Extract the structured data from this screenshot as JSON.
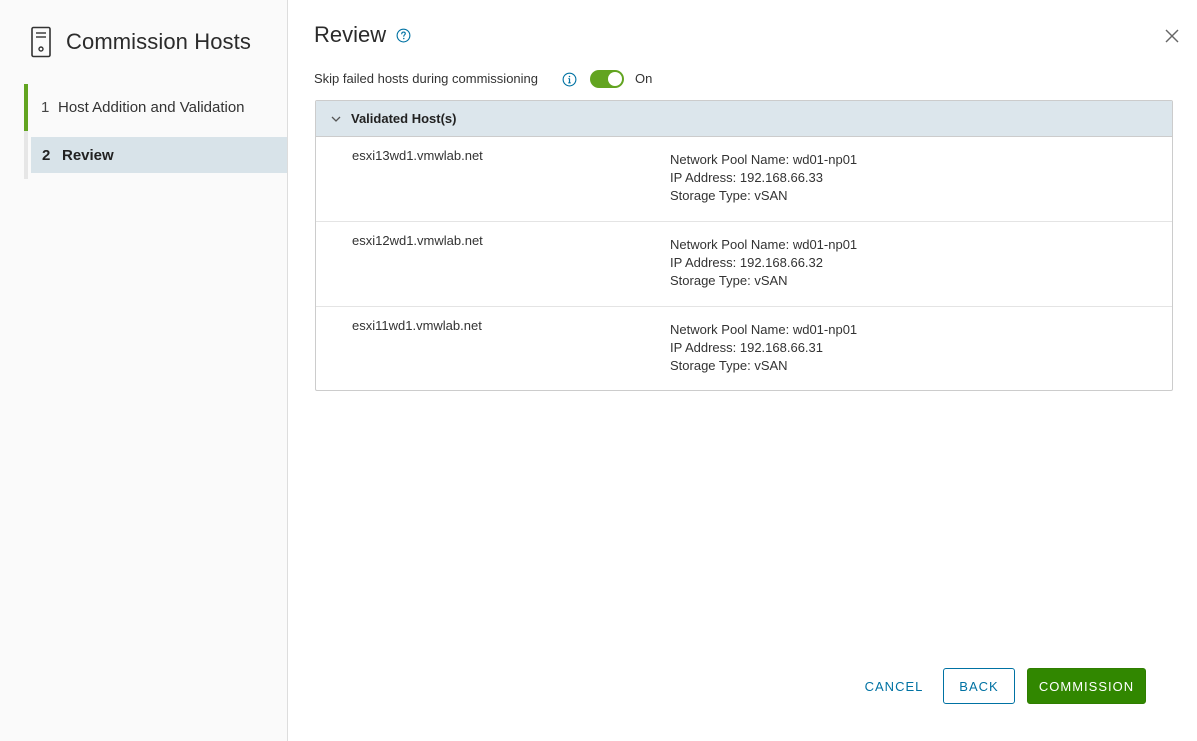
{
  "sidebar": {
    "title": "Commission Hosts",
    "steps": [
      {
        "number": "1",
        "label": "Host Addition and Validation"
      },
      {
        "number": "2",
        "label": "Review"
      }
    ]
  },
  "main": {
    "title": "Review",
    "toggle": {
      "label": "Skip failed hosts during commissioning",
      "state": "On"
    },
    "panel": {
      "title": "Validated Host(s)",
      "hosts": [
        {
          "name": "esxi13wd1.vmwlab.net",
          "pool": "Network Pool Name: wd01-np01",
          "ip": "IP Address: 192.168.66.33",
          "storage": "Storage Type: vSAN"
        },
        {
          "name": "esxi12wd1.vmwlab.net",
          "pool": "Network Pool Name: wd01-np01",
          "ip": "IP Address: 192.168.66.32",
          "storage": "Storage Type: vSAN"
        },
        {
          "name": "esxi11wd1.vmwlab.net",
          "pool": "Network Pool Name: wd01-np01",
          "ip": "IP Address: 192.168.66.31",
          "storage": "Storage Type: vSAN"
        }
      ]
    }
  },
  "buttons": {
    "cancel": "CANCEL",
    "back": "BACK",
    "commission": "COMMISSION"
  },
  "icons": {
    "header": "server-icon",
    "help": "help-circle-icon",
    "info": "info-circle-icon",
    "close": "close-icon",
    "collapse": "chevron-down-icon"
  },
  "colors": {
    "accent_green": "#62a420",
    "primary_button": "#318700",
    "link_blue": "#0072a3",
    "selected_step_bg": "#d8e3e9",
    "panel_header_bg": "#dce6ec"
  }
}
